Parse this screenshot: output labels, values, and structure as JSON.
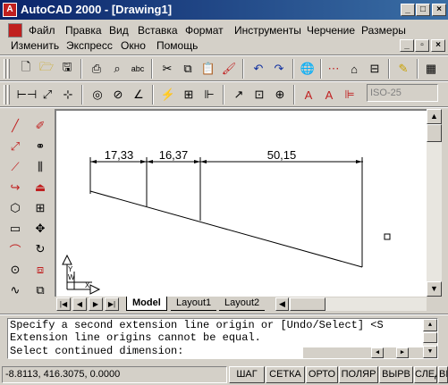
{
  "window": {
    "title": "AutoCAD 2000 - [Drawing1]",
    "min_label": "_",
    "max_label": "□",
    "close_label": "×"
  },
  "menu": {
    "row1": [
      {
        "label": "Файл"
      },
      {
        "label": "Правка"
      },
      {
        "label": "Вид"
      },
      {
        "label": "Вставка"
      },
      {
        "label": "Формат"
      },
      {
        "label": "Инструменты"
      },
      {
        "label": "Черчение"
      },
      {
        "label": "Размеры"
      }
    ],
    "row2": [
      {
        "label": "Изменить"
      },
      {
        "label": "Экспресс"
      },
      {
        "label": "Окно"
      },
      {
        "label": "Помощь"
      }
    ]
  },
  "dim_style": "ISO-25",
  "drawing": {
    "dims": [
      "17,33",
      "16,37",
      "50,15"
    ],
    "ucs_x": "X",
    "ucs_y": "Y",
    "ucs_w": "W"
  },
  "tabs": {
    "model": "Model",
    "layout1": "Layout1",
    "layout2": "Layout2"
  },
  "command": {
    "lines": [
      "Specify a second extension line origin or [Undo/Select] <S",
      "Extension line origins cannot be equal.",
      "Select continued dimension:"
    ]
  },
  "status": {
    "coords": "-8.8113,  416.3075, 0.0000",
    "toggles": [
      "ШАГ",
      "СЕТКА",
      "ОРТО",
      "ПОЛЯР",
      "ВЫРВ",
      "СЛЕД",
      "ВЕ"
    ]
  },
  "colors": {
    "titlebar": "#0a246a",
    "drawing_bg": "#ffffff",
    "chrome": "#d4d0c8"
  }
}
